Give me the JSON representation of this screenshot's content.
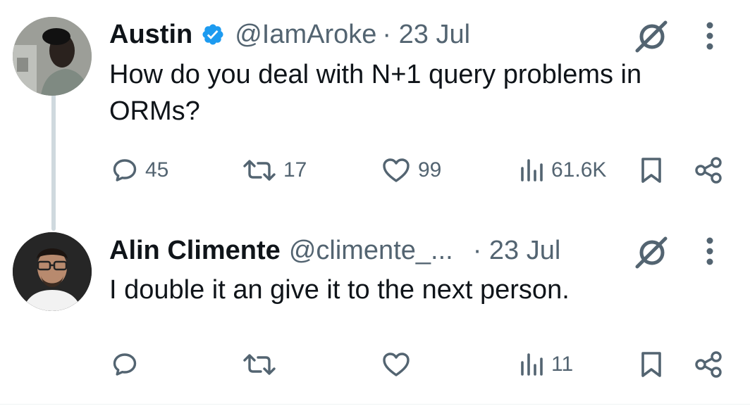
{
  "tweets": [
    {
      "name": "Austin",
      "handle": "@IamAroke",
      "date": "· 23 Jul",
      "verified": true,
      "text_lines": [
        "How do you deal with N+1 query problems in",
        "ORMs?"
      ],
      "replies": "45",
      "reposts": "17",
      "likes": "99",
      "views": "61.6K"
    },
    {
      "name": "Alin Climente",
      "handle": "@climente_...",
      "date": "· 23 Jul",
      "text_lines": [
        "I double it an give it to the next person."
      ],
      "replies": "",
      "reposts": "",
      "likes": "",
      "views": "11"
    }
  ],
  "icons": {
    "verified": "verified-badge-icon",
    "grok": "grok-icon",
    "more": "more-vertical-icon",
    "reply": "reply-icon",
    "repost": "repost-icon",
    "like": "heart-icon",
    "views": "views-icon",
    "bookmark": "bookmark-icon",
    "share": "share-icon"
  },
  "colors": {
    "text": "#0f1419",
    "secondary": "#536471",
    "verified": "#1d9bf0",
    "thread_line": "#cfd9de"
  }
}
